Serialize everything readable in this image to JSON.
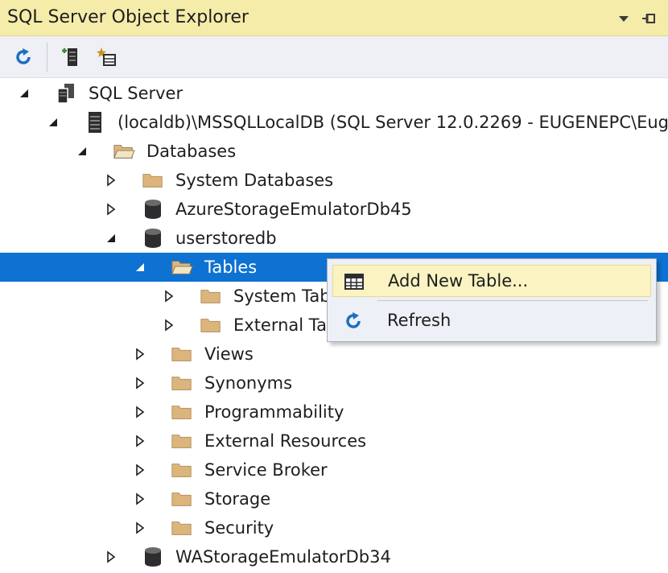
{
  "panel": {
    "title": "SQL Server Object Explorer",
    "dropdown_icon": "triangle-down-icon",
    "pin_icon": "pin-icon"
  },
  "toolbar": {
    "buttons": [
      {
        "name": "refresh",
        "icon": "refresh-icon"
      },
      {
        "name": "add-sql-server",
        "icon": "add-server-icon"
      },
      {
        "name": "filter",
        "icon": "star-filter-icon"
      }
    ]
  },
  "tree": [
    {
      "label": "SQL Server",
      "icon": "server-group-icon",
      "expanded": true
    },
    {
      "label": "(localdb)\\MSSQLLocalDB (SQL Server 12.0.2269 - EUGENEPC\\Eug",
      "icon": "server-icon",
      "expanded": true
    },
    {
      "label": "Databases",
      "icon": "folder-open-icon",
      "expanded": true
    },
    {
      "label": "System Databases",
      "icon": "folder-icon",
      "expanded": false
    },
    {
      "label": "AzureStorageEmulatorDb45",
      "icon": "database-icon",
      "expanded": false
    },
    {
      "label": "userstoredb",
      "icon": "database-icon",
      "expanded": true
    },
    {
      "label": "Tables",
      "icon": "folder-open-icon",
      "expanded": true,
      "selected": true
    },
    {
      "label": "System Tab",
      "icon": "folder-icon",
      "expanded": false
    },
    {
      "label": "External Tal",
      "icon": "folder-icon",
      "expanded": false
    },
    {
      "label": "Views",
      "icon": "folder-icon",
      "expanded": false
    },
    {
      "label": "Synonyms",
      "icon": "folder-icon",
      "expanded": false
    },
    {
      "label": "Programmability",
      "icon": "folder-icon",
      "expanded": false
    },
    {
      "label": "External Resources",
      "icon": "folder-icon",
      "expanded": false
    },
    {
      "label": "Service Broker",
      "icon": "folder-icon",
      "expanded": false
    },
    {
      "label": "Storage",
      "icon": "folder-icon",
      "expanded": false
    },
    {
      "label": "Security",
      "icon": "folder-icon",
      "expanded": false
    },
    {
      "label": "WAStorageEmulatorDb34",
      "icon": "database-icon",
      "expanded": false
    }
  ],
  "context_menu": {
    "items": [
      {
        "label": "Add New Table...",
        "icon": "table-grid-icon",
        "highlighted": true
      },
      {
        "label": "Refresh",
        "icon": "refresh-icon",
        "highlighted": false
      }
    ]
  },
  "colors": {
    "title_bar": "#f5ecaa",
    "toolbar": "#eef0f5",
    "selection": "#0e72d2",
    "folder": "#dcb57d",
    "menu_background": "#eef0f7",
    "menu_highlight": "#fbf3c2",
    "refresh_icon": "#1c6fc2"
  }
}
